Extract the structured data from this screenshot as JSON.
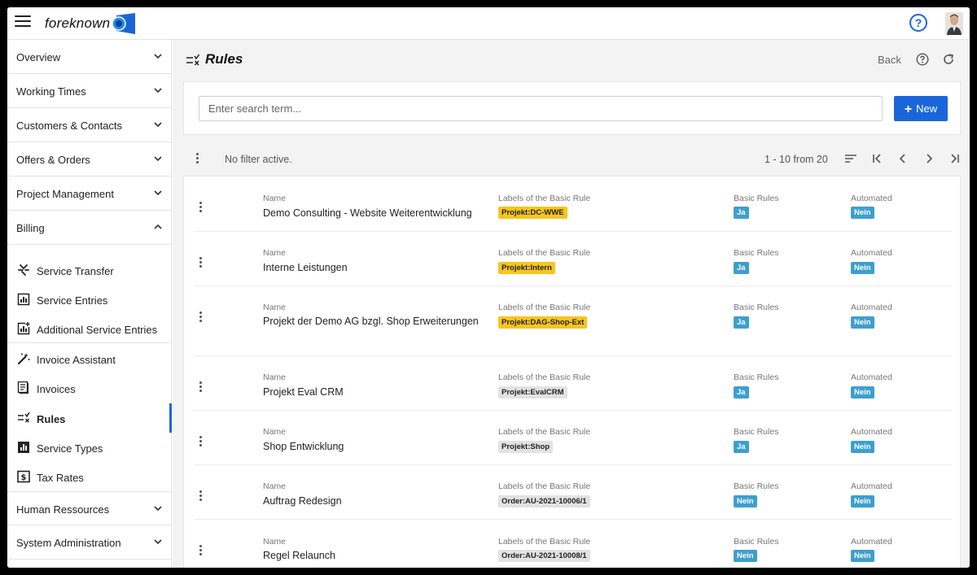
{
  "app": {
    "logo_text": "foreknown",
    "help_symbol": "?",
    "accent_color": "#1a66d9",
    "badge_color": "#3d9fce",
    "label_yellow": "#f7c51e"
  },
  "sidebar": {
    "groups": [
      {
        "label": "Overview",
        "expanded": false
      },
      {
        "label": "Working Times",
        "expanded": false
      },
      {
        "label": "Customers & Contacts",
        "expanded": false
      },
      {
        "label": "Offers & Orders",
        "expanded": false
      },
      {
        "label": "Project Management",
        "expanded": false
      },
      {
        "label": "Billing",
        "expanded": true
      },
      {
        "label": "Human Ressources",
        "expanded": false
      },
      {
        "label": "System Administration",
        "expanded": false
      }
    ],
    "billing_items": [
      {
        "label": "Service Transfer",
        "icon": "transfer-icon"
      },
      {
        "label": "Service Entries",
        "icon": "chart-icon"
      },
      {
        "label": "Additional Service Entries",
        "icon": "chart-plus-icon"
      },
      {
        "label": "Invoice Assistant",
        "icon": "magic-wand-icon"
      },
      {
        "label": "Invoices",
        "icon": "invoice-icon"
      },
      {
        "label": "Rules",
        "icon": "rules-icon",
        "active": true
      },
      {
        "label": "Service Types",
        "icon": "bar-chart-icon"
      },
      {
        "label": "Tax Rates",
        "icon": "dollar-icon"
      }
    ]
  },
  "page": {
    "title": "Rules",
    "back_label": "Back",
    "search_placeholder": "Enter search term...",
    "new_label": "New",
    "new_symbol": "+",
    "filter_text": "No filter active.",
    "pager_text": "1 - 10 from 20"
  },
  "columns": {
    "name": "Name",
    "labels": "Labels of the Basic Rule",
    "basic_rules": "Basic Rules",
    "automated": "Automated"
  },
  "rows": [
    {
      "name": "Demo Consulting - Website Weiterentwicklung",
      "label": "Projekt:DC-WWE",
      "label_style": "yellow",
      "basic_rules": "Ja",
      "automated": "Nein"
    },
    {
      "name": "Interne Leistungen",
      "label": "Projekt:Intern",
      "label_style": "yellow",
      "basic_rules": "Ja",
      "automated": "Nein"
    },
    {
      "name": "Projekt der Demo AG bzgl. Shop Erweiterungen",
      "label": "Projekt:DAG-Shop-Ext",
      "label_style": "yellow",
      "basic_rules": "Ja",
      "automated": "Nein"
    },
    {
      "name": "Projekt Eval CRM",
      "label": "Projekt:EvalCRM",
      "label_style": "grey",
      "basic_rules": "Ja",
      "automated": "Nein"
    },
    {
      "name": "Shop Entwicklung",
      "label": "Projekt:Shop",
      "label_style": "grey",
      "basic_rules": "Ja",
      "automated": "Nein"
    },
    {
      "name": "Auftrag Redesign",
      "label": "Order:AU-2021-10006/1",
      "label_style": "grey",
      "basic_rules": "Nein",
      "automated": "Nein"
    },
    {
      "name": "Regel Relaunch",
      "label": "Order:AU-2021-10008/1",
      "label_style": "grey",
      "basic_rules": "Nein",
      "automated": "Nein"
    }
  ]
}
